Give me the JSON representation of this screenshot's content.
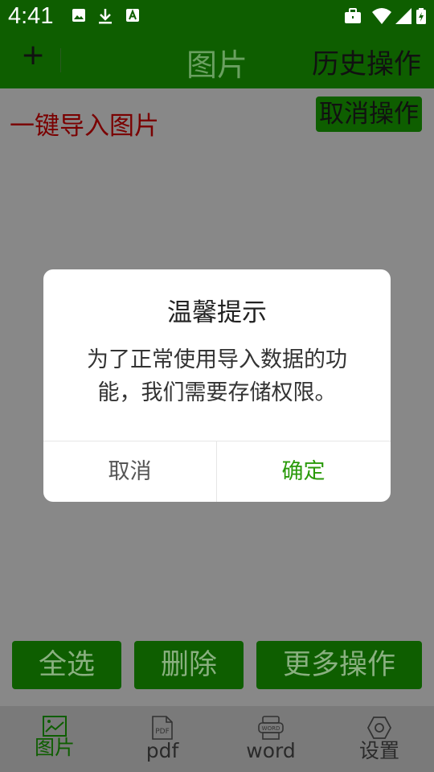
{
  "status_bar": {
    "time": "4:41"
  },
  "app_bar": {
    "add_icon_glyph": "+",
    "title": "图片",
    "history_label": "历史操作"
  },
  "content": {
    "import_label": "一键导入图片",
    "cancel_label": "取消操作"
  },
  "actions": {
    "select_all": "全选",
    "delete": "删除",
    "more": "更多操作"
  },
  "nav": [
    {
      "label": "图片",
      "icon": "image-icon",
      "active": true
    },
    {
      "label": "pdf",
      "icon": "pdf-icon",
      "active": false
    },
    {
      "label": "word",
      "icon": "word-icon",
      "active": false
    },
    {
      "label": "设置",
      "icon": "settings-icon",
      "active": false
    }
  ],
  "nav_icon_text": {
    "pdf": "PDF",
    "word": "WORD"
  },
  "dialog": {
    "title": "温馨提示",
    "message": "为了正常使用导入数据的功能，我们需要存储权限。",
    "cancel": "取消",
    "confirm": "确定"
  },
  "colors": {
    "primary": "#0e5e00",
    "confirm_text": "#2a9a0a",
    "import_text": "#7a0000",
    "active_nav": "#0e5e00"
  }
}
